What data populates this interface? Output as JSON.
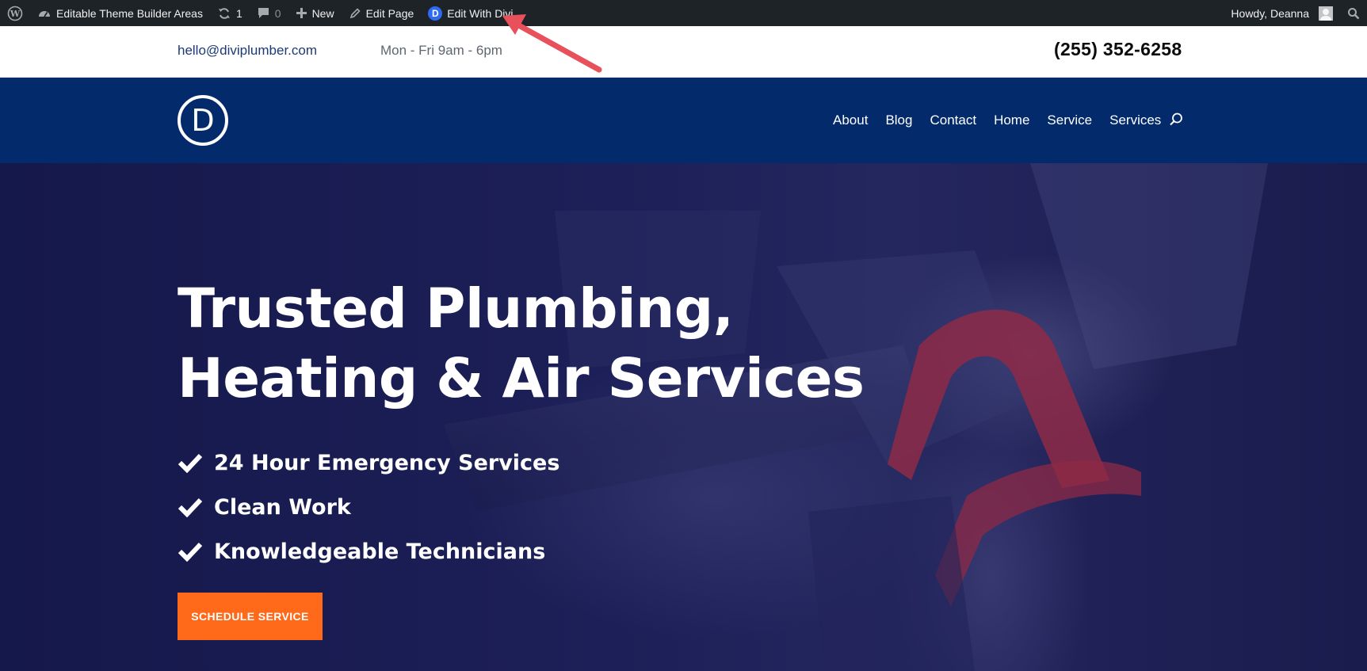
{
  "admin_bar": {
    "site_name": "Editable Theme Builder Areas",
    "updates_count": "1",
    "comments_count": "0",
    "new_label": "New",
    "edit_page_label": "Edit Page",
    "divi_badge_letter": "D",
    "edit_with_divi_label": "Edit With Divi",
    "howdy_label": "Howdy, Deanna"
  },
  "topbar": {
    "email": "hello@diviplumber.com",
    "hours": "Mon - Fri 9am - 6pm",
    "phone": "(255) 352-6258"
  },
  "header": {
    "logo_letter": "D",
    "nav_items": [
      "About",
      "Blog",
      "Contact",
      "Home",
      "Service",
      "Services"
    ]
  },
  "hero": {
    "title_line1": "Trusted Plumbing,",
    "title_line2": "Heating & Air Services",
    "checklist": [
      "24 Hour Emergency Services",
      "Clean Work",
      "Knowledgeable Technicians"
    ],
    "cta_label": "SCHEDULE SERVICE"
  },
  "colors": {
    "admin_bar_bg": "#1d2327",
    "nav_bg": "#032a6b",
    "cta_bg": "#ff6a1a",
    "annotation_arrow": "#e8505b"
  }
}
